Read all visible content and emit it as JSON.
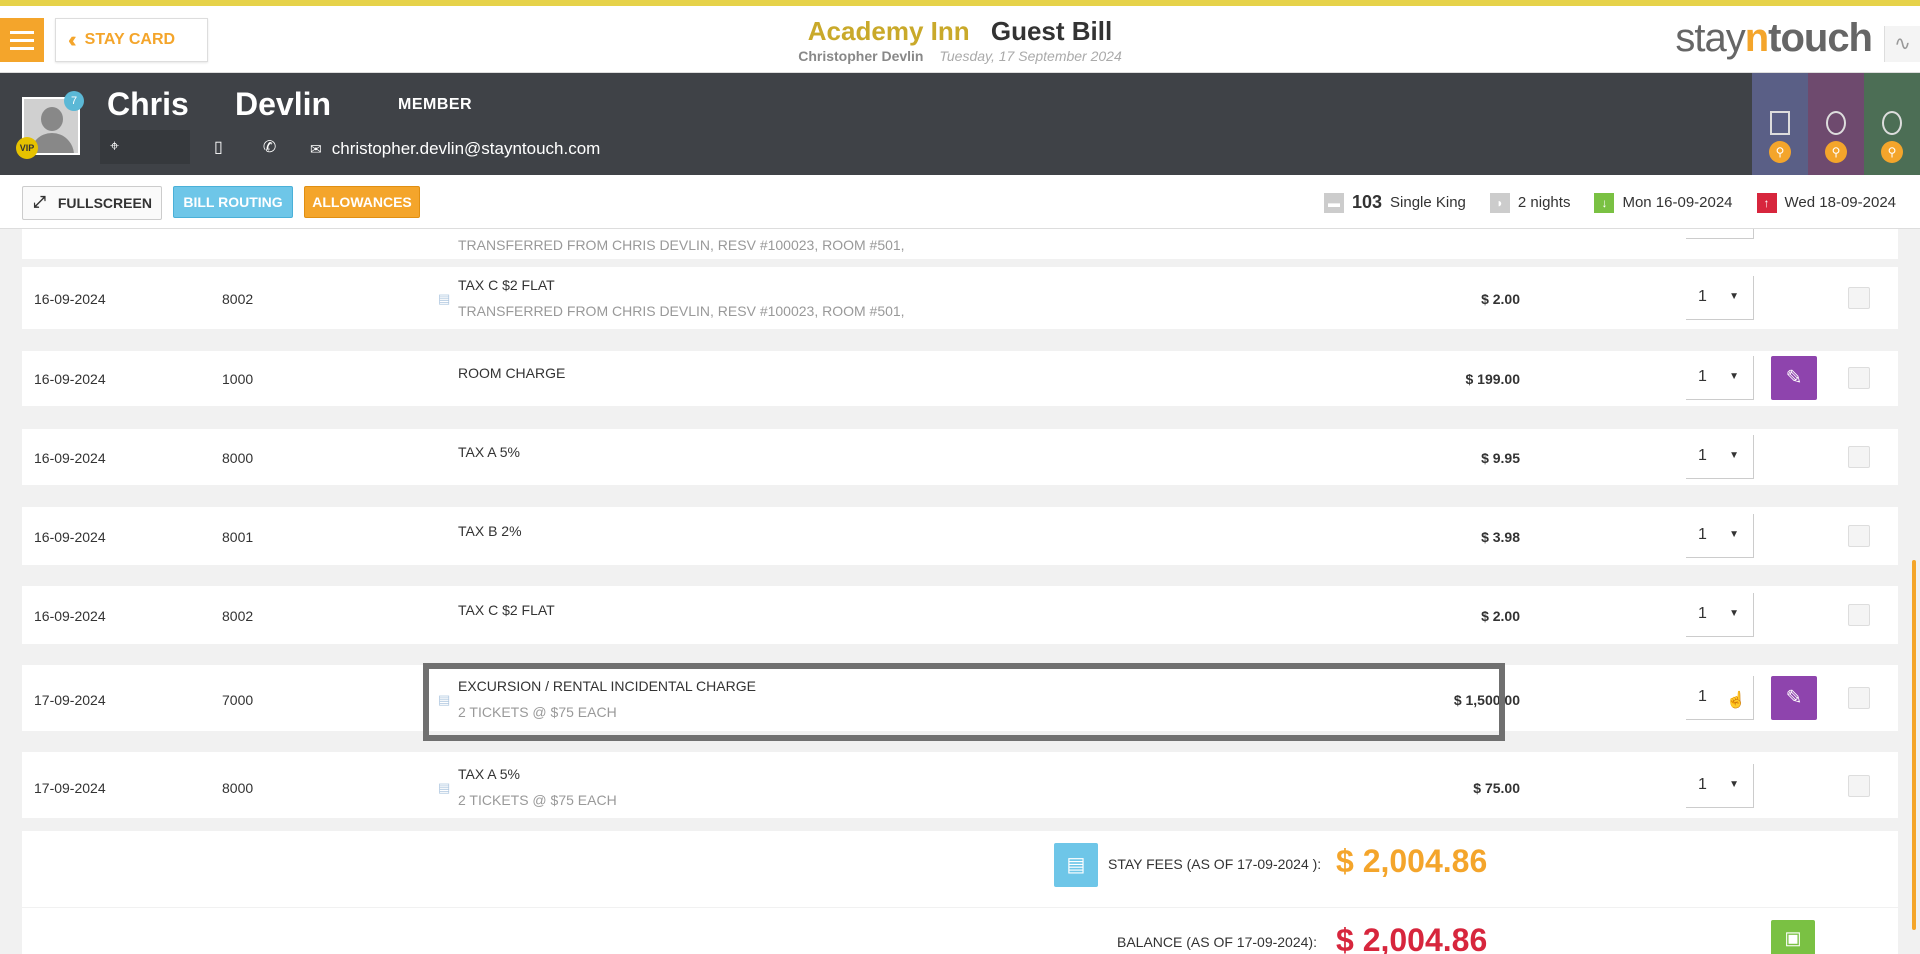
{
  "header": {
    "menu_icon": "hamburger-icon",
    "stay_card_label": "STAY CARD",
    "hotel_name": "Academy Inn",
    "page_title": "Guest Bill",
    "guest_full_name": "Christopher Devlin",
    "business_date": "Tuesday, 17 September 2024",
    "brand_logo_prefix": "stay",
    "brand_logo_mid": "n",
    "brand_logo_suffix": "touch"
  },
  "guest": {
    "first_name": "Chris",
    "last_name": "Devlin",
    "membership": "MEMBER",
    "avatar_badge_count": "7",
    "vip_label": "VIP",
    "email": "christopher.devlin@stayntouch.com"
  },
  "actions": {
    "fullscreen_label": "FULLSCREEN",
    "bill_routing_label": "BILL ROUTING",
    "allowances_label": "ALLOWANCES"
  },
  "stay": {
    "room_number": "103",
    "room_type": "Single King",
    "nights": "2 nights",
    "arrival": "Mon 16-09-2024",
    "departure": "Wed 18-09-2024"
  },
  "colors": {
    "accent": "#f4a52b",
    "routing": "#6ec6e8",
    "edit": "#8e44ad",
    "balance": "#d7263d",
    "arrival": "#7ac143"
  },
  "transactions": {
    "partial_top_sub": "TRANSFERRED FROM CHRIS DEVLIN, RESV #100023, ROOM #501,",
    "rows": [
      {
        "date": "16-09-2024",
        "code": "8002",
        "desc": "TAX C $2 FLAT",
        "sub": "TRANSFERRED FROM CHRIS DEVLIN, RESV #100023, ROOM #501,",
        "amount": "$ 2.00",
        "qty": "1"
      },
      {
        "date": "16-09-2024",
        "code": "1000",
        "desc": "ROOM CHARGE",
        "sub": "",
        "amount": "$ 199.00",
        "qty": "1"
      },
      {
        "date": "16-09-2024",
        "code": "8000",
        "desc": "TAX A 5%",
        "sub": "",
        "amount": "$ 9.95",
        "qty": "1"
      },
      {
        "date": "16-09-2024",
        "code": "8001",
        "desc": "TAX B 2%",
        "sub": "",
        "amount": "$ 3.98",
        "qty": "1"
      },
      {
        "date": "16-09-2024",
        "code": "8002",
        "desc": "TAX C $2 FLAT",
        "sub": "",
        "amount": "$ 2.00",
        "qty": "1"
      },
      {
        "date": "17-09-2024",
        "code": "7000",
        "desc": "EXCURSION / RENTAL INCIDENTAL CHARGE",
        "sub": "2 TICKETS @ $75 EACH",
        "amount": "$ 1,500.00",
        "qty": "1"
      },
      {
        "date": "17-09-2024",
        "code": "8000",
        "desc": "TAX A 5%",
        "sub": "2 TICKETS @ $75 EACH",
        "amount": "$ 75.00",
        "qty": "1"
      }
    ]
  },
  "summary": {
    "stay_fees_label": "STAY FEES (AS OF  17-09-2024 ):",
    "stay_fees_amount": "$ 2,004.86",
    "balance_label": "BALANCE (AS OF  17-09-2024):",
    "balance_amount": "$ 2,004.86"
  }
}
